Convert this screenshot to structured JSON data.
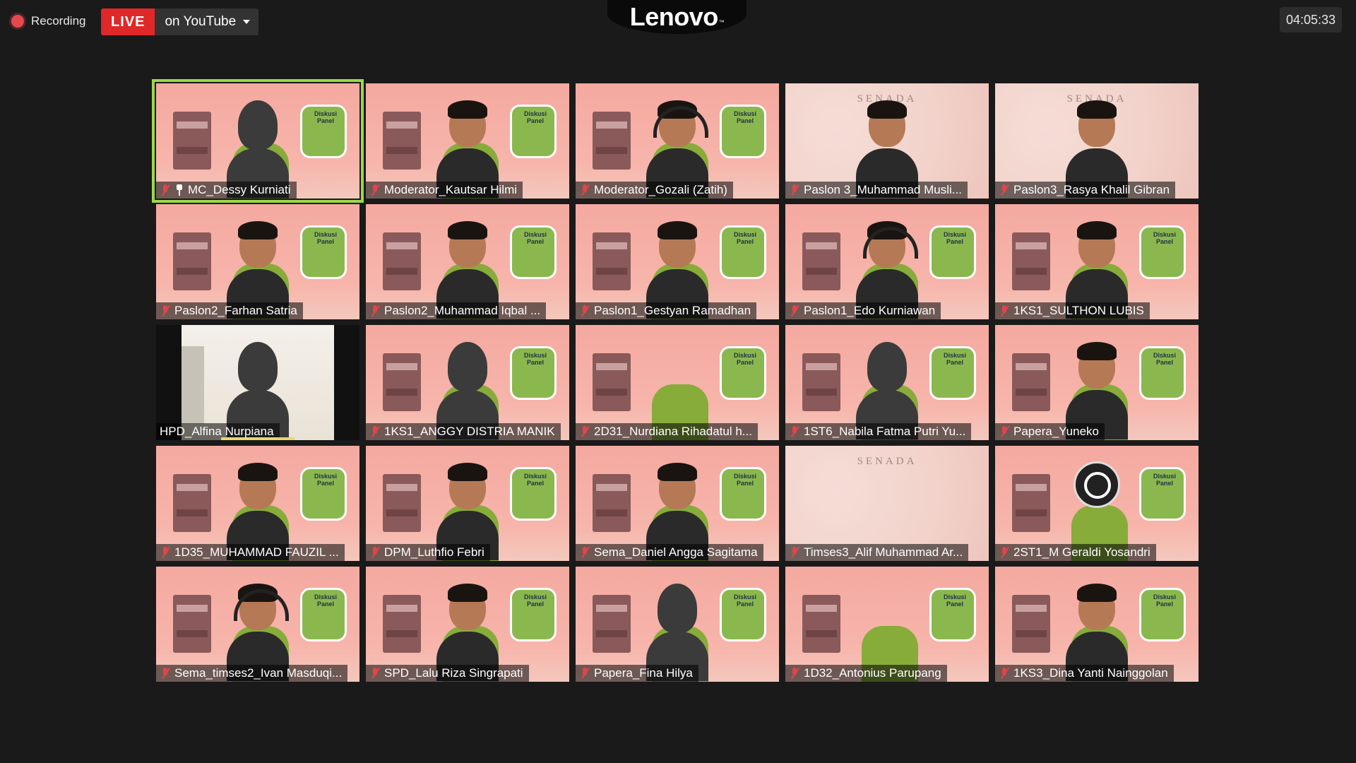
{
  "topbar": {
    "recording_label": "Recording",
    "live_badge": "LIVE",
    "stream_target": "on YouTube",
    "logo_text": "Lenovo",
    "elapsed_time": "04:05:33"
  },
  "participants": [
    {
      "name": "MC_Dessy Kurniati",
      "muted": true,
      "pinned": true,
      "speaking": true,
      "bg": "room",
      "person": "hijab"
    },
    {
      "name": "Moderator_Kautsar Hilmi",
      "muted": true,
      "bg": "room",
      "person": "man"
    },
    {
      "name": "Moderator_Gozali (Zatih)",
      "muted": true,
      "bg": "room",
      "person": "headset"
    },
    {
      "name": "Paslon 3_Muhammad Musli...",
      "muted": true,
      "bg": "senada",
      "person": "man"
    },
    {
      "name": "Paslon3_Rasya Khalil Gibran",
      "muted": true,
      "bg": "senada",
      "person": "man"
    },
    {
      "name": "Paslon2_Farhan Satria",
      "muted": true,
      "bg": "room",
      "person": "man"
    },
    {
      "name": "Paslon2_Muhammad Iqbal ...",
      "muted": true,
      "bg": "room",
      "person": "man"
    },
    {
      "name": "Paslon1_Gestyan Ramadhan",
      "muted": true,
      "bg": "room",
      "person": "man"
    },
    {
      "name": "Paslon1_Edo Kurniawan",
      "muted": true,
      "bg": "room",
      "person": "headset"
    },
    {
      "name": "1KS1_SULTHON LUBIS",
      "muted": true,
      "bg": "room",
      "person": "man"
    },
    {
      "name": "HPD_Alfina Nurpiana",
      "muted": false,
      "bg": "home",
      "person": "hijab"
    },
    {
      "name": "1KS1_ANGGY DISTRIA MANIK",
      "muted": true,
      "bg": "room",
      "person": "hijab"
    },
    {
      "name": "2D31_Nurdiana Rihadatul h...",
      "muted": true,
      "bg": "room",
      "person": "none"
    },
    {
      "name": "1ST6_Nabila Fatma Putri Yu...",
      "muted": true,
      "bg": "room",
      "person": "hijab"
    },
    {
      "name": "Papera_Yuneko",
      "muted": true,
      "bg": "room",
      "person": "man"
    },
    {
      "name": "1D35_MUHAMMAD FAUZIL ...",
      "muted": true,
      "bg": "room",
      "person": "man"
    },
    {
      "name": "DPM_Luthfio Febri",
      "muted": true,
      "bg": "room",
      "person": "man"
    },
    {
      "name": "Sema_Daniel Angga Sagitama",
      "muted": true,
      "bg": "room",
      "person": "man"
    },
    {
      "name": "Timses3_Alif Muhammad Ar...",
      "muted": true,
      "bg": "senada",
      "person": "none"
    },
    {
      "name": "2ST1_M Geraldi Yosandri",
      "muted": true,
      "bg": "room",
      "person": "obs"
    },
    {
      "name": "Sema_timses2_Ivan Masduqi...",
      "muted": true,
      "bg": "room",
      "person": "headset"
    },
    {
      "name": "SPD_Lalu Riza Singrapati",
      "muted": true,
      "bg": "room",
      "person": "man"
    },
    {
      "name": "Papera_Fina Hilya",
      "muted": true,
      "bg": "room",
      "person": "hijab"
    },
    {
      "name": "1D32_Antonius Parupang",
      "muted": true,
      "bg": "room",
      "person": "none"
    },
    {
      "name": "1KS3_Dina Yanti Nainggolan",
      "muted": true,
      "bg": "room",
      "person": "man"
    }
  ],
  "room_board_text": "Diskusi Panel",
  "senada_title": "SENADA",
  "colors": {
    "live_red": "#e02828",
    "speaking_border": "#9bd84a",
    "muted_icon": "#e0454a",
    "background": "#1a1a1a"
  }
}
